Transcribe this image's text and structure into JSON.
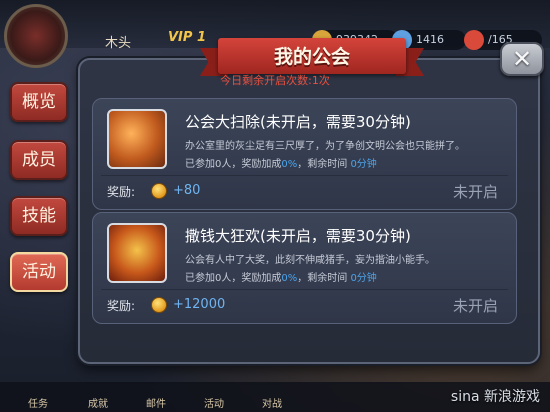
{
  "header": {
    "player_name": "木头",
    "vip": "VIP 1",
    "gold": "939342",
    "gems": "1416",
    "energy": "165",
    "energy_max": "/165"
  },
  "side_tabs": [
    {
      "label": "概览",
      "active": false
    },
    {
      "label": "成员",
      "active": false
    },
    {
      "label": "技能",
      "active": false
    },
    {
      "label": "活动",
      "active": true
    }
  ],
  "bottom_bar": [
    "任务",
    "成就",
    "邮件",
    "活动",
    "对战"
  ],
  "panel": {
    "title": "我的公会",
    "subtitle": "今日剩余开启次数:1次"
  },
  "events": [
    {
      "icon": "broom-icon",
      "title": "公会大扫除(未开启，需要30分钟)",
      "desc": "办公室里的灰尘足有三尺厚了，为了争创文明公会也只能拼了。",
      "joined_prefix": "已参加",
      "joined_count": "0",
      "joined_unit": "人，奖励加成",
      "bonus": "0%",
      "remaining_prefix": "，剩余时间",
      "remaining": "0分钟",
      "reward_label": "奖励:",
      "reward_value": "+80",
      "status": "未开启"
    },
    {
      "icon": "coins-icon",
      "title": "撒钱大狂欢(未开启，需要30分钟)",
      "desc": "公会有人中了大奖，此刻不伸咸猪手，妄为揩油小能手。",
      "joined_prefix": "已参加",
      "joined_count": "0",
      "joined_unit": "人，奖励加成",
      "bonus": "0%",
      "remaining_prefix": "，剩余时间",
      "remaining": "0分钟",
      "reward_label": "奖励:",
      "reward_value": "+12000",
      "status": "未开启"
    }
  ],
  "close_glyph": "✕",
  "watermark": "sina 新浪游戏",
  "colors": {
    "accent_red": "#c2493f",
    "blue_text": "#4ba3ea",
    "status_gray": "#9aa3b5"
  }
}
